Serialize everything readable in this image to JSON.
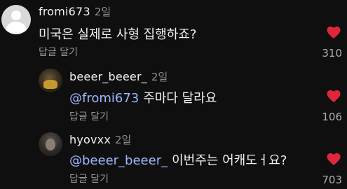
{
  "comments": [
    {
      "username": "fromi673",
      "time": "2일",
      "mention": "",
      "text": "미국은 실제로 사형 집행하죠?",
      "reply_label": "답글 달기",
      "likes": "310"
    },
    {
      "username": "beeer_beeer_",
      "time": "2일",
      "mention": "@fromi673",
      "text": "주마다 달라요",
      "reply_label": "답글 달기",
      "likes": "106"
    },
    {
      "username": "hyovxx",
      "time": "2일",
      "mention": "@beeer_beeer_",
      "text": "이번주는 어캐도ㅓ요?",
      "reply_label": "답글 달기",
      "likes": "703"
    }
  ],
  "colors": {
    "background": "#0f0f0f",
    "heart": "#e0263a",
    "mention": "#9fb8ff"
  }
}
